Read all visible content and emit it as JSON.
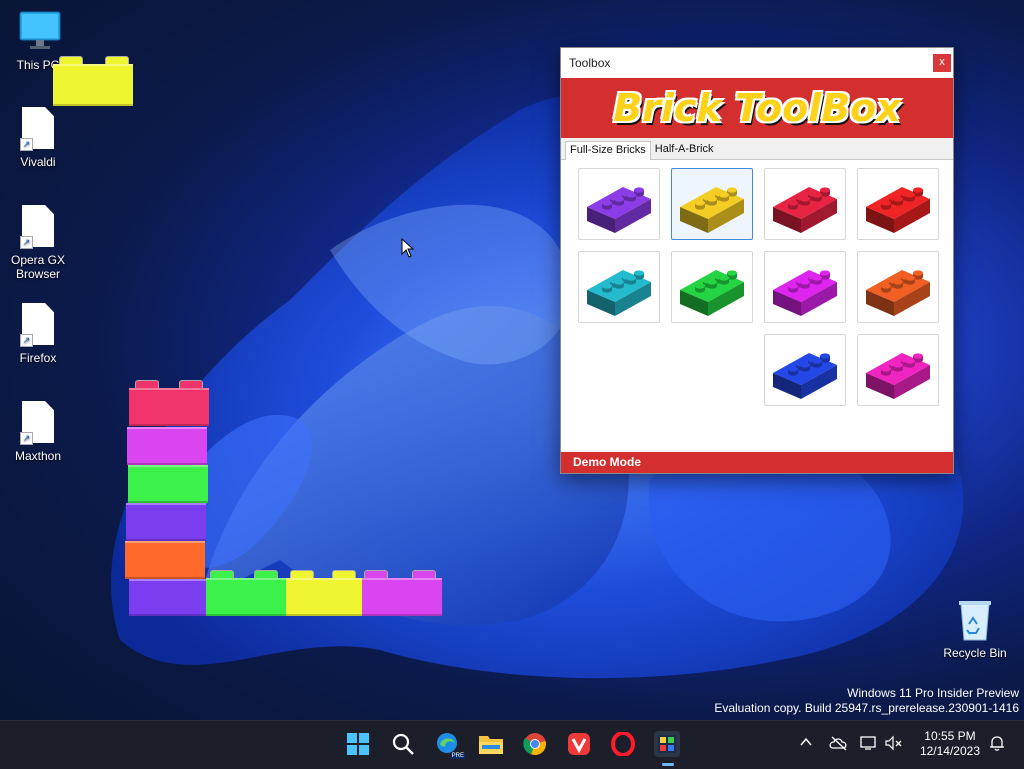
{
  "desktop": {
    "icons": [
      {
        "label": "This PC",
        "icon": "monitor-icon"
      },
      {
        "label": "Vivaldi",
        "icon": "shortcut-file-icon"
      },
      {
        "label": "Opera GX Browser",
        "icon": "shortcut-file-icon"
      },
      {
        "label": "Firefox",
        "icon": "shortcut-file-icon"
      },
      {
        "label": "Maxthon",
        "icon": "shortcut-file-icon"
      },
      {
        "label": "Recycle Bin",
        "icon": "recycle-bin-icon"
      }
    ]
  },
  "bricks_colors": {
    "yellow": "#f0f532",
    "pink": "#f0336b",
    "magenta": "#d946ef",
    "green": "#3cf24a",
    "purple": "#7a3df0",
    "orange": "#ff6a2b"
  },
  "toolbox": {
    "title": "Toolbox",
    "close_label": "x",
    "banner": "Brick ToolBox",
    "tabs": [
      {
        "label": "Full-Size Bricks",
        "active": true
      },
      {
        "label": "Half-A-Brick",
        "active": false
      }
    ],
    "bricks": [
      {
        "color": "#7a35c9",
        "name": "purple"
      },
      {
        "color": "#d4b21f",
        "name": "yellow",
        "selected": true
      },
      {
        "color": "#c91f3a",
        "name": "crimson"
      },
      {
        "color": "#d11f1f",
        "name": "red"
      },
      {
        "color": "#1fa3b3",
        "name": "teal"
      },
      {
        "color": "#1fb83a",
        "name": "green"
      },
      {
        "color": "#c21fd1",
        "name": "magenta"
      },
      {
        "color": "#d2531f",
        "name": "orange"
      },
      {
        "color": "#1f3fc9",
        "name": "blue"
      },
      {
        "color": "#d11fa8",
        "name": "pink"
      }
    ],
    "status": "Demo Mode",
    "accent": "#d32f2f"
  },
  "watermark": {
    "line1": "Windows 11 Pro Insider Preview",
    "line2": "Evaluation copy. Build 25947.rs_prerelease.230901-1416"
  },
  "taskbar": {
    "apps": [
      "start-icon",
      "search-icon",
      "edge-pre-icon",
      "file-explorer-icon",
      "chrome-icon",
      "vivaldi-icon",
      "opera-icon",
      "brick-toolbox-icon"
    ],
    "edge_badge": "PRE",
    "time": "10:55 PM",
    "date": "12/14/2023"
  }
}
